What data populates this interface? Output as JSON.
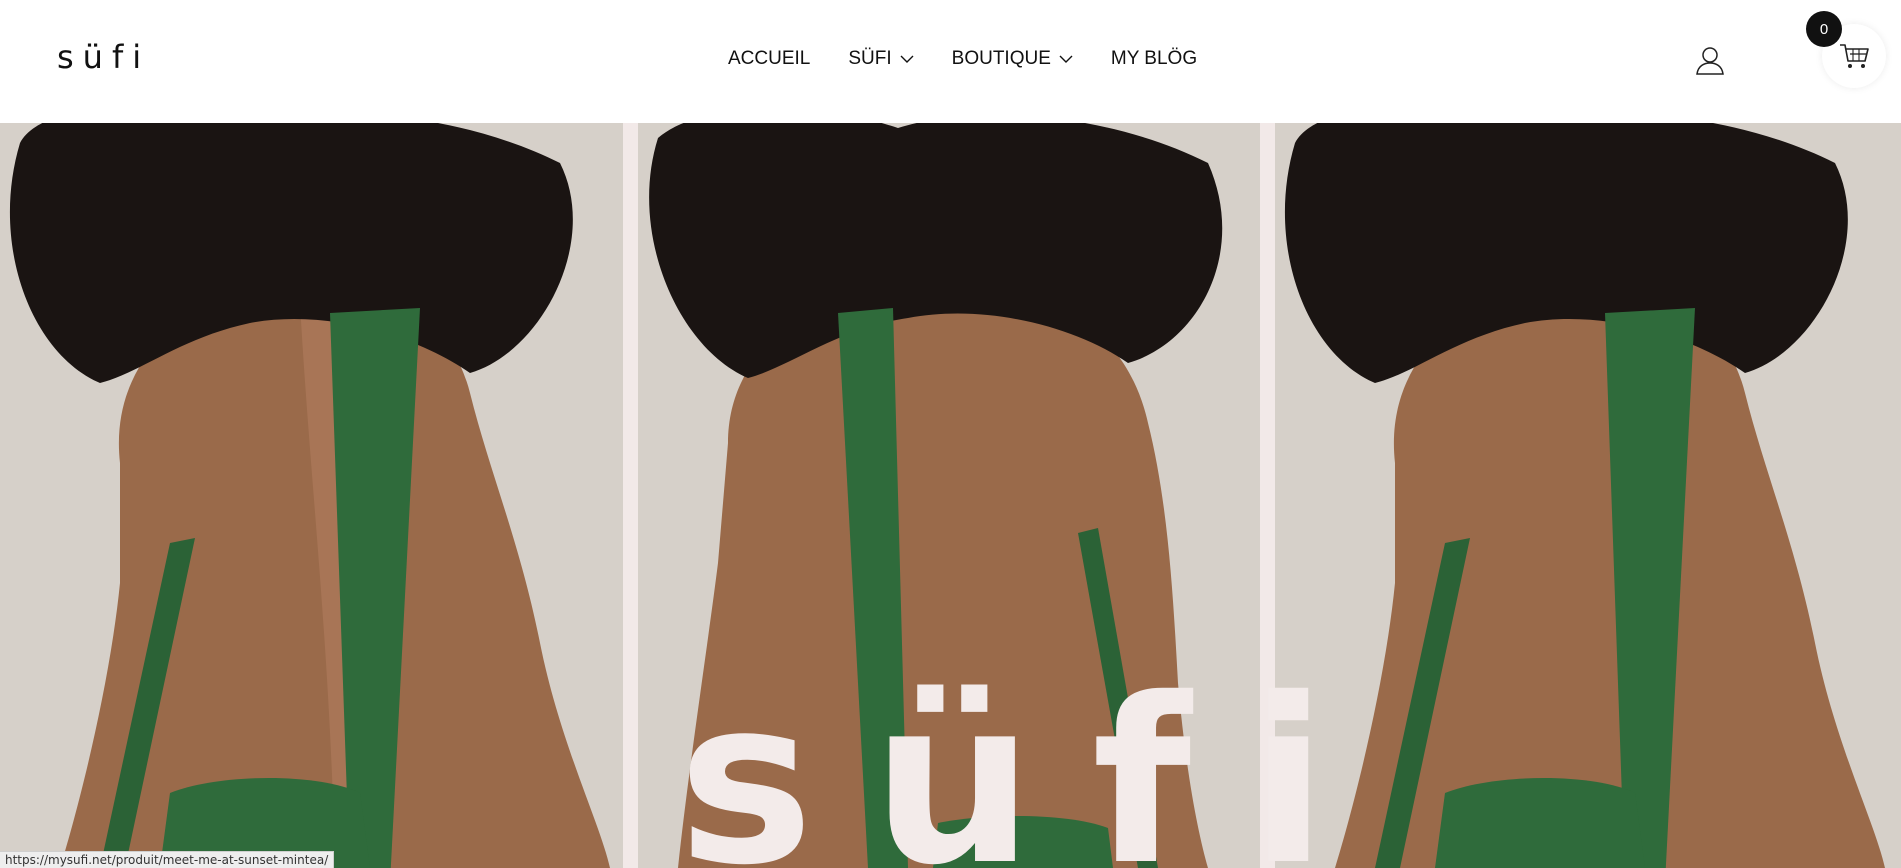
{
  "header": {
    "logo": "süfi",
    "nav": [
      {
        "label": "ACCUEIL",
        "has_dropdown": false
      },
      {
        "label": "SÜFI",
        "has_dropdown": true
      },
      {
        "label": "BOUTIQUE",
        "has_dropdown": true
      },
      {
        "label": "MY BLÖG",
        "has_dropdown": false
      }
    ],
    "account_icon": "user-icon",
    "cart_icon": "cart-icon",
    "cart_count": "0"
  },
  "hero": {
    "word": "süfi",
    "panels": [
      "model-back-green-bag",
      "model-back-green-bag",
      "model-back-green-bag"
    ]
  },
  "status_bar": {
    "url": "https://mysufi.net/produit/meet-me-at-sunset-mintea/"
  },
  "colors": {
    "hero_text": "#f3ebea",
    "bag_green": "#2f6b3b",
    "skin": "#9a6a4a",
    "panel_gap": "#f2e9e8"
  }
}
